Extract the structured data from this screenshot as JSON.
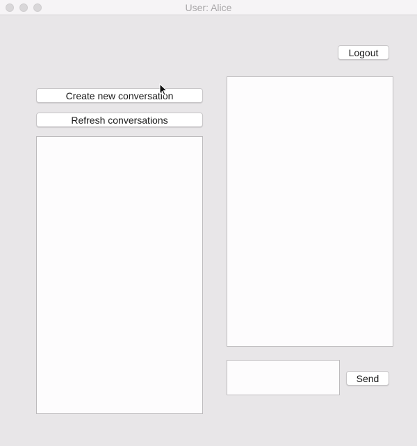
{
  "window": {
    "title": "User: Alice"
  },
  "header": {
    "logout_label": "Logout"
  },
  "sidebar": {
    "create_label": "Create new conversation",
    "refresh_label": "Refresh conversations"
  },
  "composer": {
    "send_label": "Send",
    "message_value": ""
  },
  "icons": {
    "window_close": "close-dot-icon",
    "window_minimize": "minimize-dot-icon",
    "window_zoom": "zoom-dot-icon",
    "pointer": "mouse-pointer-icon"
  }
}
